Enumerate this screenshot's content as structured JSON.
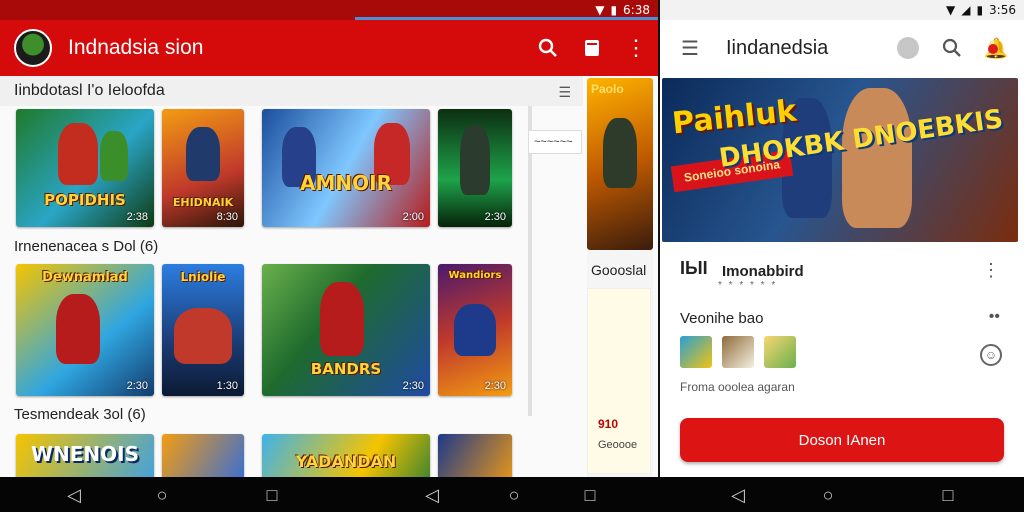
{
  "status_left": {
    "time": "6:38"
  },
  "status_right": {
    "time": "3:56"
  },
  "left_app": {
    "title": "Indnadsia sion",
    "section_header": "Iinbdotasl I'o Ieloofda",
    "sections": [
      {
        "label": "",
        "tiles": [
          {
            "title": "POPIDHIS",
            "price": "2:38"
          },
          {
            "title": "EHIDNAIK",
            "price": "8:30"
          },
          {
            "title": "AMNOIR",
            "price": "2:00"
          },
          {
            "title": "",
            "price": "2:30"
          }
        ]
      },
      {
        "label": "Irnenenacea s Dol (6)",
        "tiles": [
          {
            "title": "Dewnamlad",
            "price": "2:30"
          },
          {
            "title": "Lniolie",
            "price": "1:30"
          },
          {
            "title": "BANDRS",
            "price": "2:30"
          },
          {
            "title": "Wandiors",
            "price": "2:30"
          }
        ]
      },
      {
        "label": "Tesmendeak 3ol (6)",
        "tiles": [
          {
            "title": "WNENOIS",
            "price": ""
          },
          {
            "title": "",
            "price": ""
          },
          {
            "title": "YADANDAN",
            "price": ""
          },
          {
            "title": "",
            "price": ""
          }
        ]
      }
    ],
    "side_banner_title": "Paolo",
    "side_section_label": "Goooslal",
    "side_card_code": "910",
    "side_card_foot": "Geoooe",
    "list_badge": "~~~~~~"
  },
  "right_app": {
    "title": "Iindanedsia",
    "hero": {
      "title_left": "Paihluk",
      "ribbon": "Soneioo sonoina",
      "title_right": "DHOKBK DNOEBKIS"
    },
    "app_badge": "IЫI",
    "app_name": "Imonabbird",
    "app_rating": "* * * * * *",
    "version_label": "Veonihe bao",
    "caption": "Froma ooolea agaran",
    "primary_button": "Doson IAnen"
  },
  "colors": {
    "brand_red": "#d50a0a",
    "button_red": "#dc1414"
  }
}
